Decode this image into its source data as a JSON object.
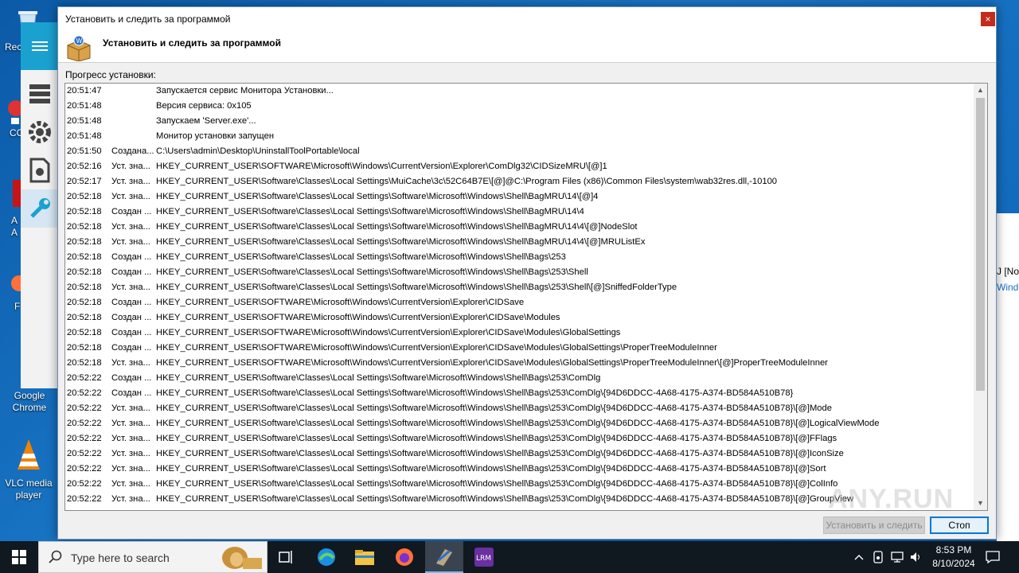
{
  "desktop": {
    "icons": [
      {
        "label": "Rec"
      },
      {
        "label": "CC"
      },
      {
        "label": "A\nA"
      },
      {
        "label": "F"
      },
      {
        "label": "Google Chrome"
      },
      {
        "label": "VLC media player"
      }
    ],
    "bg_window_text_1": "J [No",
    "bg_window_text_2": "Windo"
  },
  "dialog": {
    "title": "Установить и следить за программой",
    "header_title": "Установить и следить за программой",
    "close_label": "×",
    "progress_label": "Прогресс установки:",
    "install_button": "Установить и следить",
    "stop_button": "Стоп",
    "watermark": "ANY.RUN"
  },
  "log": [
    {
      "time": "20:51:47",
      "action": "",
      "detail": "Запускается сервис Монитора Установки..."
    },
    {
      "time": "20:51:48",
      "action": "",
      "detail": "Версия сервиса: 0x105"
    },
    {
      "time": "20:51:48",
      "action": "",
      "detail": "Запускаем 'Server.exe'..."
    },
    {
      "time": "20:51:48",
      "action": "",
      "detail": "Монитор установки запущен"
    },
    {
      "time": "20:51:50",
      "action": "Создана...",
      "detail": "C:\\Users\\admin\\Desktop\\UninstallToolPortable\\local"
    },
    {
      "time": "20:52:16",
      "action": "Уст. зна...",
      "detail": "HKEY_CURRENT_USER\\SOFTWARE\\Microsoft\\Windows\\CurrentVersion\\Explorer\\ComDlg32\\CIDSizeMRU\\[@]1"
    },
    {
      "time": "20:52:17",
      "action": "Уст. зна...",
      "detail": "HKEY_CURRENT_USER\\Software\\Classes\\Local Settings\\MuiCache\\3c\\52C64B7E\\[@]@C:\\Program Files (x86)\\Common Files\\system\\wab32res.dll,-10100"
    },
    {
      "time": "20:52:18",
      "action": "Уст. зна...",
      "detail": "HKEY_CURRENT_USER\\Software\\Classes\\Local Settings\\Software\\Microsoft\\Windows\\Shell\\BagMRU\\14\\[@]4"
    },
    {
      "time": "20:52:18",
      "action": "Создан ...",
      "detail": "HKEY_CURRENT_USER\\Software\\Classes\\Local Settings\\Software\\Microsoft\\Windows\\Shell\\BagMRU\\14\\4"
    },
    {
      "time": "20:52:18",
      "action": "Уст. зна...",
      "detail": "HKEY_CURRENT_USER\\Software\\Classes\\Local Settings\\Software\\Microsoft\\Windows\\Shell\\BagMRU\\14\\4\\[@]NodeSlot"
    },
    {
      "time": "20:52:18",
      "action": "Уст. зна...",
      "detail": "HKEY_CURRENT_USER\\Software\\Classes\\Local Settings\\Software\\Microsoft\\Windows\\Shell\\BagMRU\\14\\4\\[@]MRUListEx"
    },
    {
      "time": "20:52:18",
      "action": "Создан ...",
      "detail": "HKEY_CURRENT_USER\\Software\\Classes\\Local Settings\\Software\\Microsoft\\Windows\\Shell\\Bags\\253"
    },
    {
      "time": "20:52:18",
      "action": "Создан ...",
      "detail": "HKEY_CURRENT_USER\\Software\\Classes\\Local Settings\\Software\\Microsoft\\Windows\\Shell\\Bags\\253\\Shell"
    },
    {
      "time": "20:52:18",
      "action": "Уст. зна...",
      "detail": "HKEY_CURRENT_USER\\Software\\Classes\\Local Settings\\Software\\Microsoft\\Windows\\Shell\\Bags\\253\\Shell\\[@]SniffedFolderType"
    },
    {
      "time": "20:52:18",
      "action": "Создан ...",
      "detail": "HKEY_CURRENT_USER\\SOFTWARE\\Microsoft\\Windows\\CurrentVersion\\Explorer\\CIDSave"
    },
    {
      "time": "20:52:18",
      "action": "Создан ...",
      "detail": "HKEY_CURRENT_USER\\SOFTWARE\\Microsoft\\Windows\\CurrentVersion\\Explorer\\CIDSave\\Modules"
    },
    {
      "time": "20:52:18",
      "action": "Создан ...",
      "detail": "HKEY_CURRENT_USER\\SOFTWARE\\Microsoft\\Windows\\CurrentVersion\\Explorer\\CIDSave\\Modules\\GlobalSettings"
    },
    {
      "time": "20:52:18",
      "action": "Создан ...",
      "detail": "HKEY_CURRENT_USER\\SOFTWARE\\Microsoft\\Windows\\CurrentVersion\\Explorer\\CIDSave\\Modules\\GlobalSettings\\ProperTreeModuleInner"
    },
    {
      "time": "20:52:18",
      "action": "Уст. зна...",
      "detail": "HKEY_CURRENT_USER\\SOFTWARE\\Microsoft\\Windows\\CurrentVersion\\Explorer\\CIDSave\\Modules\\GlobalSettings\\ProperTreeModuleInner\\[@]ProperTreeModuleInner"
    },
    {
      "time": "20:52:22",
      "action": "Создан ...",
      "detail": "HKEY_CURRENT_USER\\Software\\Classes\\Local Settings\\Software\\Microsoft\\Windows\\Shell\\Bags\\253\\ComDlg"
    },
    {
      "time": "20:52:22",
      "action": "Создан ...",
      "detail": "HKEY_CURRENT_USER\\Software\\Classes\\Local Settings\\Software\\Microsoft\\Windows\\Shell\\Bags\\253\\ComDlg\\{94D6DDCC-4A68-4175-A374-BD584A510B78}"
    },
    {
      "time": "20:52:22",
      "action": "Уст. зна...",
      "detail": "HKEY_CURRENT_USER\\Software\\Classes\\Local Settings\\Software\\Microsoft\\Windows\\Shell\\Bags\\253\\ComDlg\\{94D6DDCC-4A68-4175-A374-BD584A510B78}\\[@]Mode"
    },
    {
      "time": "20:52:22",
      "action": "Уст. зна...",
      "detail": "HKEY_CURRENT_USER\\Software\\Classes\\Local Settings\\Software\\Microsoft\\Windows\\Shell\\Bags\\253\\ComDlg\\{94D6DDCC-4A68-4175-A374-BD584A510B78}\\[@]LogicalViewMode"
    },
    {
      "time": "20:52:22",
      "action": "Уст. зна...",
      "detail": "HKEY_CURRENT_USER\\Software\\Classes\\Local Settings\\Software\\Microsoft\\Windows\\Shell\\Bags\\253\\ComDlg\\{94D6DDCC-4A68-4175-A374-BD584A510B78}\\[@]FFlags"
    },
    {
      "time": "20:52:22",
      "action": "Уст. зна...",
      "detail": "HKEY_CURRENT_USER\\Software\\Classes\\Local Settings\\Software\\Microsoft\\Windows\\Shell\\Bags\\253\\ComDlg\\{94D6DDCC-4A68-4175-A374-BD584A510B78}\\[@]IconSize"
    },
    {
      "time": "20:52:22",
      "action": "Уст. зна...",
      "detail": "HKEY_CURRENT_USER\\Software\\Classes\\Local Settings\\Software\\Microsoft\\Windows\\Shell\\Bags\\253\\ComDlg\\{94D6DDCC-4A68-4175-A374-BD584A510B78}\\[@]Sort"
    },
    {
      "time": "20:52:22",
      "action": "Уст. зна...",
      "detail": "HKEY_CURRENT_USER\\Software\\Classes\\Local Settings\\Software\\Microsoft\\Windows\\Shell\\Bags\\253\\ComDlg\\{94D6DDCC-4A68-4175-A374-BD584A510B78}\\[@]ColInfo"
    },
    {
      "time": "20:52:22",
      "action": "Уст. зна...",
      "detail": "HKEY_CURRENT_USER\\Software\\Classes\\Local Settings\\Software\\Microsoft\\Windows\\Shell\\Bags\\253\\ComDlg\\{94D6DDCC-4A68-4175-A374-BD584A510B78}\\[@]GroupView"
    }
  ],
  "taskbar": {
    "search_placeholder": "Type here to search",
    "time": "8:53 PM",
    "date": "8/10/2024"
  },
  "icons": {
    "start": "windows-start-icon",
    "search": "search-icon",
    "task_view": "task-view-icon",
    "edge": "edge-icon",
    "explorer": "file-explorer-icon",
    "firefox": "firefox-icon",
    "uninstall_tool": "uninstall-tool-icon",
    "lrm": "lrm-icon"
  },
  "colors": {
    "accent": "#0078d7",
    "close": "#c42b1c",
    "sidebar_accent": "#1ba1d0"
  }
}
